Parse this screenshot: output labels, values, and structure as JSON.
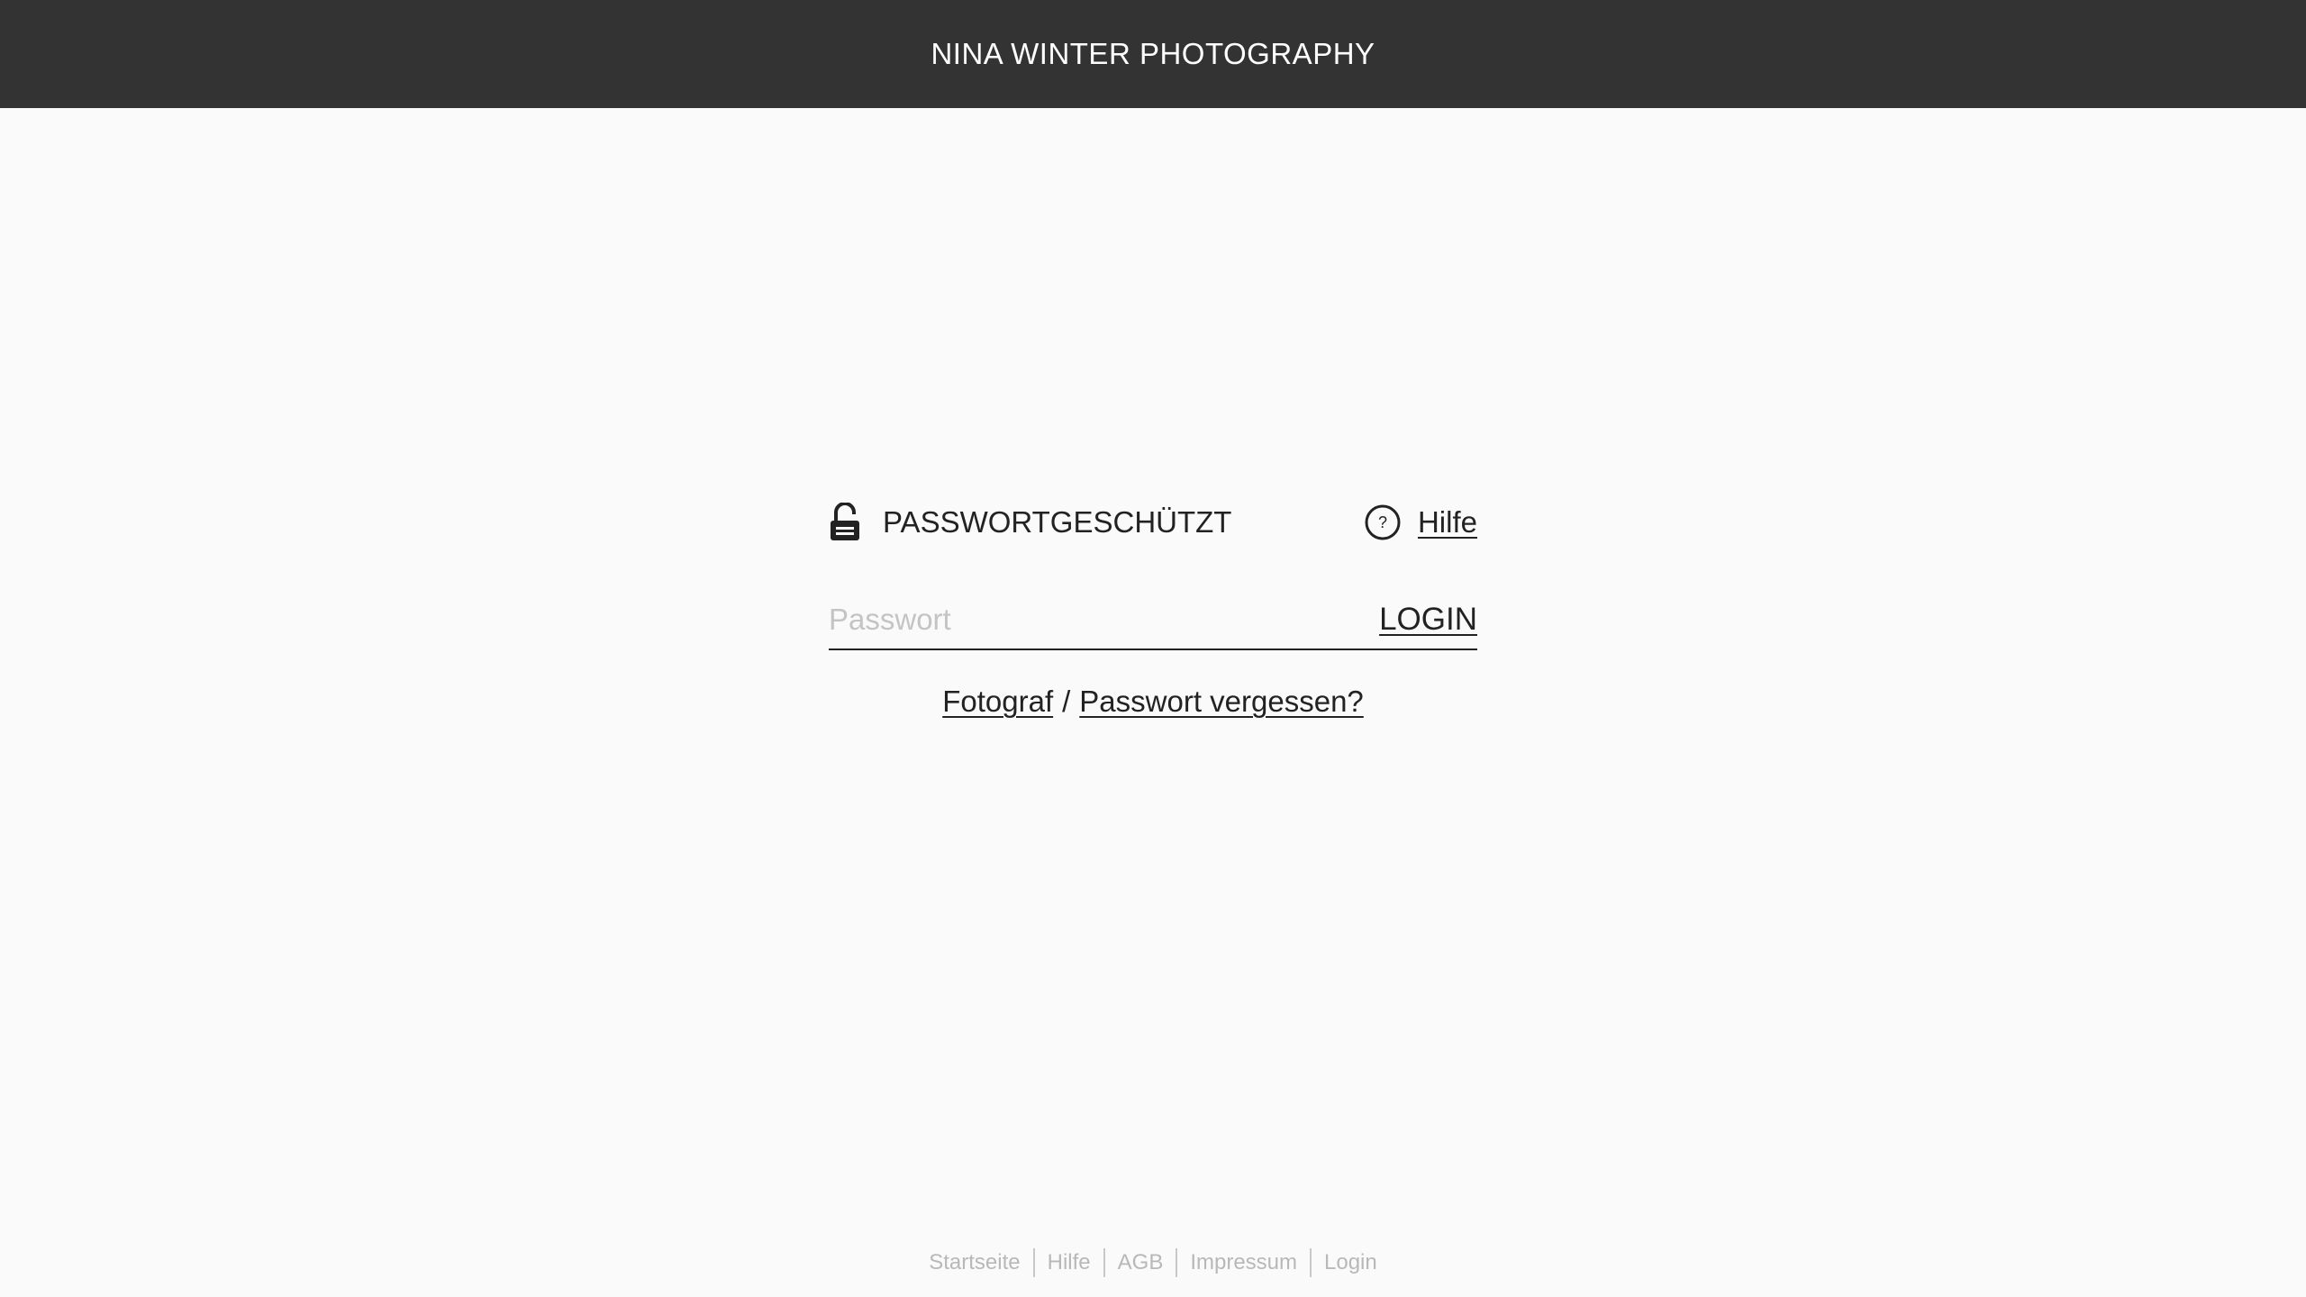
{
  "header": {
    "title": "NINA WINTER PHOTOGRAPHY"
  },
  "login": {
    "protected_label": "PASSWORTGESCHÜTZT",
    "protected_icon": "lock-open-icon",
    "help_label": "Hilfe",
    "help_icon": "question-circle-icon",
    "password_placeholder": "Passwort",
    "password_value": "",
    "login_button": "LOGIN",
    "photographer_link": "Fotograf",
    "link_separator": "/",
    "forgot_link": "Passwort vergessen?"
  },
  "footer": {
    "links": [
      "Startseite",
      "Hilfe",
      "AGB",
      "Impressum",
      "Login"
    ]
  },
  "colors": {
    "header_bg": "#333333",
    "page_bg": "#fafafa",
    "text": "#222222",
    "footer_text": "#b8b8b8"
  }
}
